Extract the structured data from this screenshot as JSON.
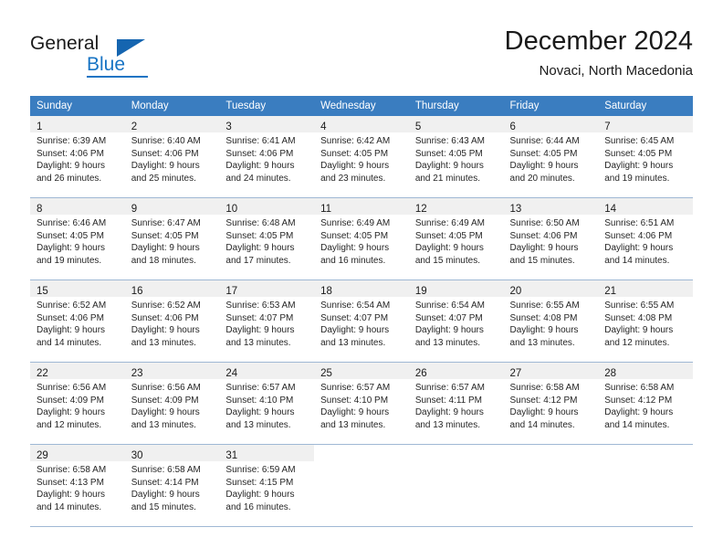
{
  "brand": {
    "name_part1": "General",
    "name_part2": "Blue",
    "logo_icon": "triangle-flag-icon"
  },
  "header": {
    "title": "December 2024",
    "subtitle": "Novaci, North Macedonia"
  },
  "colors": {
    "header_row_bg": "#3a7dc0",
    "daynum_band_bg": "#f0f0f0",
    "grid_line": "#9fb8d4",
    "brand_blue": "#1874c4",
    "text": "#262626"
  },
  "weekday_headers": [
    "Sunday",
    "Monday",
    "Tuesday",
    "Wednesday",
    "Thursday",
    "Friday",
    "Saturday"
  ],
  "weeks": [
    [
      {
        "day": "1",
        "sunrise": "Sunrise: 6:39 AM",
        "sunset": "Sunset: 4:06 PM",
        "daylight1": "Daylight: 9 hours",
        "daylight2": "and 26 minutes."
      },
      {
        "day": "2",
        "sunrise": "Sunrise: 6:40 AM",
        "sunset": "Sunset: 4:06 PM",
        "daylight1": "Daylight: 9 hours",
        "daylight2": "and 25 minutes."
      },
      {
        "day": "3",
        "sunrise": "Sunrise: 6:41 AM",
        "sunset": "Sunset: 4:06 PM",
        "daylight1": "Daylight: 9 hours",
        "daylight2": "and 24 minutes."
      },
      {
        "day": "4",
        "sunrise": "Sunrise: 6:42 AM",
        "sunset": "Sunset: 4:05 PM",
        "daylight1": "Daylight: 9 hours",
        "daylight2": "and 23 minutes."
      },
      {
        "day": "5",
        "sunrise": "Sunrise: 6:43 AM",
        "sunset": "Sunset: 4:05 PM",
        "daylight1": "Daylight: 9 hours",
        "daylight2": "and 21 minutes."
      },
      {
        "day": "6",
        "sunrise": "Sunrise: 6:44 AM",
        "sunset": "Sunset: 4:05 PM",
        "daylight1": "Daylight: 9 hours",
        "daylight2": "and 20 minutes."
      },
      {
        "day": "7",
        "sunrise": "Sunrise: 6:45 AM",
        "sunset": "Sunset: 4:05 PM",
        "daylight1": "Daylight: 9 hours",
        "daylight2": "and 19 minutes."
      }
    ],
    [
      {
        "day": "8",
        "sunrise": "Sunrise: 6:46 AM",
        "sunset": "Sunset: 4:05 PM",
        "daylight1": "Daylight: 9 hours",
        "daylight2": "and 19 minutes."
      },
      {
        "day": "9",
        "sunrise": "Sunrise: 6:47 AM",
        "sunset": "Sunset: 4:05 PM",
        "daylight1": "Daylight: 9 hours",
        "daylight2": "and 18 minutes."
      },
      {
        "day": "10",
        "sunrise": "Sunrise: 6:48 AM",
        "sunset": "Sunset: 4:05 PM",
        "daylight1": "Daylight: 9 hours",
        "daylight2": "and 17 minutes."
      },
      {
        "day": "11",
        "sunrise": "Sunrise: 6:49 AM",
        "sunset": "Sunset: 4:05 PM",
        "daylight1": "Daylight: 9 hours",
        "daylight2": "and 16 minutes."
      },
      {
        "day": "12",
        "sunrise": "Sunrise: 6:49 AM",
        "sunset": "Sunset: 4:05 PM",
        "daylight1": "Daylight: 9 hours",
        "daylight2": "and 15 minutes."
      },
      {
        "day": "13",
        "sunrise": "Sunrise: 6:50 AM",
        "sunset": "Sunset: 4:06 PM",
        "daylight1": "Daylight: 9 hours",
        "daylight2": "and 15 minutes."
      },
      {
        "day": "14",
        "sunrise": "Sunrise: 6:51 AM",
        "sunset": "Sunset: 4:06 PM",
        "daylight1": "Daylight: 9 hours",
        "daylight2": "and 14 minutes."
      }
    ],
    [
      {
        "day": "15",
        "sunrise": "Sunrise: 6:52 AM",
        "sunset": "Sunset: 4:06 PM",
        "daylight1": "Daylight: 9 hours",
        "daylight2": "and 14 minutes."
      },
      {
        "day": "16",
        "sunrise": "Sunrise: 6:52 AM",
        "sunset": "Sunset: 4:06 PM",
        "daylight1": "Daylight: 9 hours",
        "daylight2": "and 13 minutes."
      },
      {
        "day": "17",
        "sunrise": "Sunrise: 6:53 AM",
        "sunset": "Sunset: 4:07 PM",
        "daylight1": "Daylight: 9 hours",
        "daylight2": "and 13 minutes."
      },
      {
        "day": "18",
        "sunrise": "Sunrise: 6:54 AM",
        "sunset": "Sunset: 4:07 PM",
        "daylight1": "Daylight: 9 hours",
        "daylight2": "and 13 minutes."
      },
      {
        "day": "19",
        "sunrise": "Sunrise: 6:54 AM",
        "sunset": "Sunset: 4:07 PM",
        "daylight1": "Daylight: 9 hours",
        "daylight2": "and 13 minutes."
      },
      {
        "day": "20",
        "sunrise": "Sunrise: 6:55 AM",
        "sunset": "Sunset: 4:08 PM",
        "daylight1": "Daylight: 9 hours",
        "daylight2": "and 13 minutes."
      },
      {
        "day": "21",
        "sunrise": "Sunrise: 6:55 AM",
        "sunset": "Sunset: 4:08 PM",
        "daylight1": "Daylight: 9 hours",
        "daylight2": "and 12 minutes."
      }
    ],
    [
      {
        "day": "22",
        "sunrise": "Sunrise: 6:56 AM",
        "sunset": "Sunset: 4:09 PM",
        "daylight1": "Daylight: 9 hours",
        "daylight2": "and 12 minutes."
      },
      {
        "day": "23",
        "sunrise": "Sunrise: 6:56 AM",
        "sunset": "Sunset: 4:09 PM",
        "daylight1": "Daylight: 9 hours",
        "daylight2": "and 13 minutes."
      },
      {
        "day": "24",
        "sunrise": "Sunrise: 6:57 AM",
        "sunset": "Sunset: 4:10 PM",
        "daylight1": "Daylight: 9 hours",
        "daylight2": "and 13 minutes."
      },
      {
        "day": "25",
        "sunrise": "Sunrise: 6:57 AM",
        "sunset": "Sunset: 4:10 PM",
        "daylight1": "Daylight: 9 hours",
        "daylight2": "and 13 minutes."
      },
      {
        "day": "26",
        "sunrise": "Sunrise: 6:57 AM",
        "sunset": "Sunset: 4:11 PM",
        "daylight1": "Daylight: 9 hours",
        "daylight2": "and 13 minutes."
      },
      {
        "day": "27",
        "sunrise": "Sunrise: 6:58 AM",
        "sunset": "Sunset: 4:12 PM",
        "daylight1": "Daylight: 9 hours",
        "daylight2": "and 14 minutes."
      },
      {
        "day": "28",
        "sunrise": "Sunrise: 6:58 AM",
        "sunset": "Sunset: 4:12 PM",
        "daylight1": "Daylight: 9 hours",
        "daylight2": "and 14 minutes."
      }
    ],
    [
      {
        "day": "29",
        "sunrise": "Sunrise: 6:58 AM",
        "sunset": "Sunset: 4:13 PM",
        "daylight1": "Daylight: 9 hours",
        "daylight2": "and 14 minutes."
      },
      {
        "day": "30",
        "sunrise": "Sunrise: 6:58 AM",
        "sunset": "Sunset: 4:14 PM",
        "daylight1": "Daylight: 9 hours",
        "daylight2": "and 15 minutes."
      },
      {
        "day": "31",
        "sunrise": "Sunrise: 6:59 AM",
        "sunset": "Sunset: 4:15 PM",
        "daylight1": "Daylight: 9 hours",
        "daylight2": "and 16 minutes."
      },
      {
        "day": "",
        "sunrise": "",
        "sunset": "",
        "daylight1": "",
        "daylight2": ""
      },
      {
        "day": "",
        "sunrise": "",
        "sunset": "",
        "daylight1": "",
        "daylight2": ""
      },
      {
        "day": "",
        "sunrise": "",
        "sunset": "",
        "daylight1": "",
        "daylight2": ""
      },
      {
        "day": "",
        "sunrise": "",
        "sunset": "",
        "daylight1": "",
        "daylight2": ""
      }
    ]
  ]
}
